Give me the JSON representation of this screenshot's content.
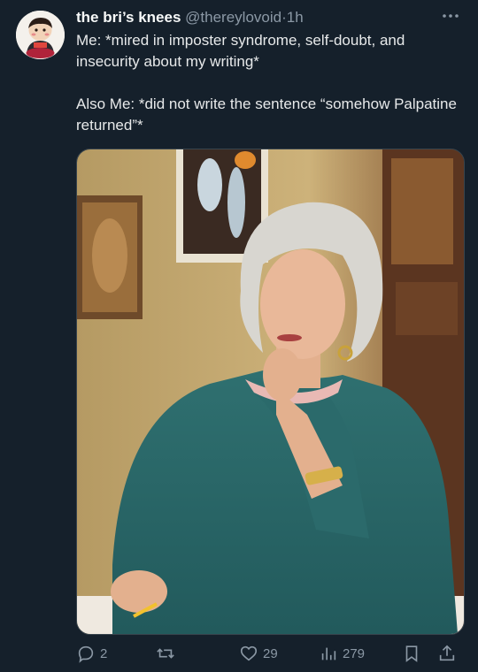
{
  "post": {
    "author_name": "the bri’s knees",
    "handle": "@thereylovoid",
    "separator": "·",
    "time": "1h",
    "text_line1": "Me: *mired in imposter syndrome, self-doubt, and insecurity about my writing*",
    "text_line2": "Also Me: *did not write the sentence “somehow Palpatine returned”*"
  },
  "media": {
    "icon": "photo-icon"
  },
  "actions": {
    "reply_count": "2",
    "retweet_count": "",
    "like_count": "29",
    "views_count": "279"
  },
  "colors": {
    "background": "#15202b",
    "text": "#e7e9ea",
    "muted": "#8b98a5",
    "accent": "#1d9bf0"
  }
}
